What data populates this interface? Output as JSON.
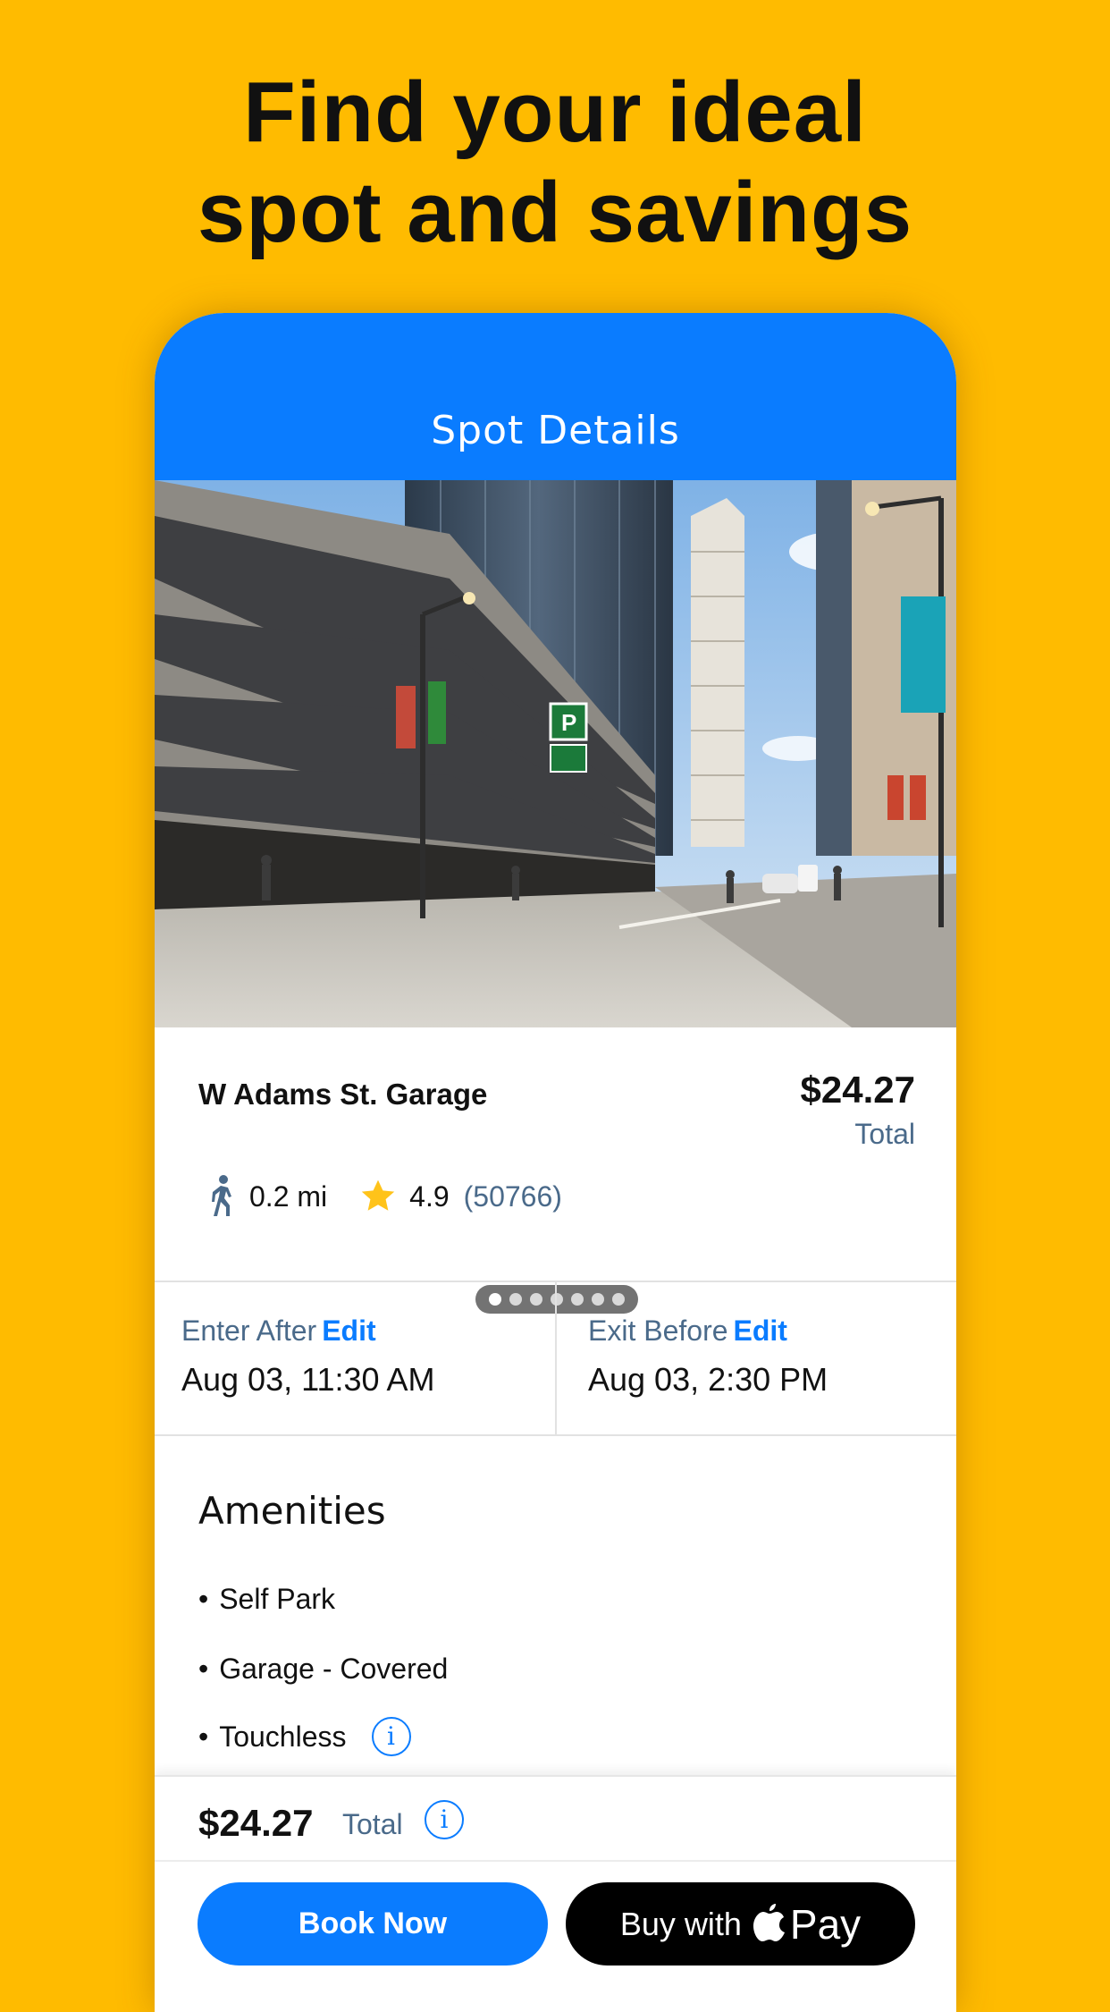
{
  "headline": {
    "line1": "Find your ideal",
    "line2": "spot and savings"
  },
  "nav": {
    "title": "Spot Details"
  },
  "photo": {
    "carousel_total": 7,
    "carousel_active_index": 0
  },
  "spot": {
    "name": "W Adams St. Garage",
    "price": "$24.27",
    "price_label": "Total",
    "distance": "0.2 mi",
    "rating": "4.9",
    "reviews": "(50766)"
  },
  "times": {
    "enter_label": "Enter After",
    "enter_edit": "Edit",
    "enter_value": "Aug 03, 11:30 AM",
    "exit_label": "Exit Before",
    "exit_edit": "Edit",
    "exit_value": "Aug 03, 2:30 PM"
  },
  "amenities": {
    "title": "Amenities",
    "bullet": "•",
    "items": [
      "Self Park",
      "Garage - Covered",
      "Touchless"
    ]
  },
  "footer": {
    "price": "$24.27",
    "total_label": "Total",
    "book_label": "Book Now",
    "pay_prefix": "Buy with",
    "pay_suffix": "Pay"
  },
  "colors": {
    "background": "#FFBB00",
    "accent": "#0A7CFF",
    "muted_text": "#4a6a8a"
  },
  "icons": [
    "walking-person-icon",
    "star-icon",
    "info-icon",
    "apple-logo-icon"
  ]
}
